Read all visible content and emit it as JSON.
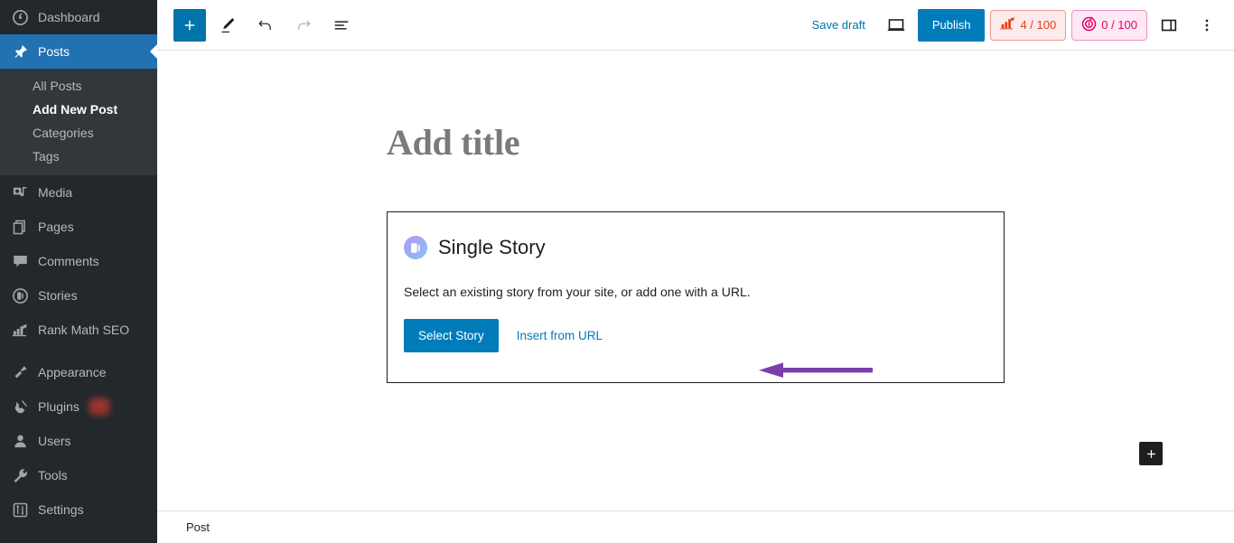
{
  "sidebar": {
    "items": [
      {
        "label": "Dashboard",
        "icon": "dashboard-icon",
        "current": false,
        "submenu": []
      },
      {
        "label": "Posts",
        "icon": "pin-icon",
        "current": true,
        "submenu": [
          {
            "label": "All Posts",
            "current": false
          },
          {
            "label": "Add New Post",
            "current": true
          },
          {
            "label": "Categories",
            "current": false
          },
          {
            "label": "Tags",
            "current": false
          }
        ]
      },
      {
        "label": "Media",
        "icon": "media-icon",
        "current": false,
        "submenu": []
      },
      {
        "label": "Pages",
        "icon": "pages-icon",
        "current": false,
        "submenu": []
      },
      {
        "label": "Comments",
        "icon": "comments-icon",
        "current": false,
        "submenu": []
      },
      {
        "label": "Stories",
        "icon": "stories-icon",
        "current": false,
        "submenu": []
      },
      {
        "label": "Rank Math SEO",
        "icon": "rank-math-icon",
        "current": false,
        "submenu": []
      },
      {
        "label": "Appearance",
        "icon": "appearance-icon",
        "current": false,
        "submenu": []
      },
      {
        "label": "Plugins",
        "icon": "plugins-icon",
        "current": false,
        "badge": "",
        "submenu": []
      },
      {
        "label": "Users",
        "icon": "users-icon",
        "current": false,
        "submenu": []
      },
      {
        "label": "Tools",
        "icon": "tools-icon",
        "current": false,
        "submenu": []
      },
      {
        "label": "Settings",
        "icon": "settings-icon",
        "current": false,
        "submenu": []
      }
    ]
  },
  "header": {
    "inserter_label": "+",
    "tools_icon": "pencil-icon",
    "undo_icon": "undo-icon",
    "redo_icon": "redo-icon",
    "list_view_icon": "list-view-icon",
    "save_draft_label": "Save draft",
    "preview_icon": "preview-desktop-icon",
    "publish_label": "Publish",
    "seo_score": "4 / 100",
    "ai_score": "0 / 100",
    "settings_toggle_icon": "sidebar-toggle-icon",
    "more_menu_icon": "kebab-menu-icon"
  },
  "canvas": {
    "title_placeholder": "Add title",
    "block": {
      "icon": "web-stories-block-icon",
      "title": "Single Story",
      "description": "Select an existing story from your site, or add one with a URL.",
      "select_button": "Select Story",
      "insert_url_link": "Insert from URL"
    },
    "appender_label": "+"
  },
  "footer": {
    "breadcrumb": "Post"
  },
  "colors": {
    "admin_bg": "#23282d",
    "admin_submenu_bg": "#32373c",
    "admin_current": "#2271b1",
    "wp_blue": "#007cba",
    "inserter_blue": "#0073aa",
    "seo_red": "#e2401c",
    "ai_pink": "#e5006d",
    "annotation_purple": "#7b3fa9"
  }
}
